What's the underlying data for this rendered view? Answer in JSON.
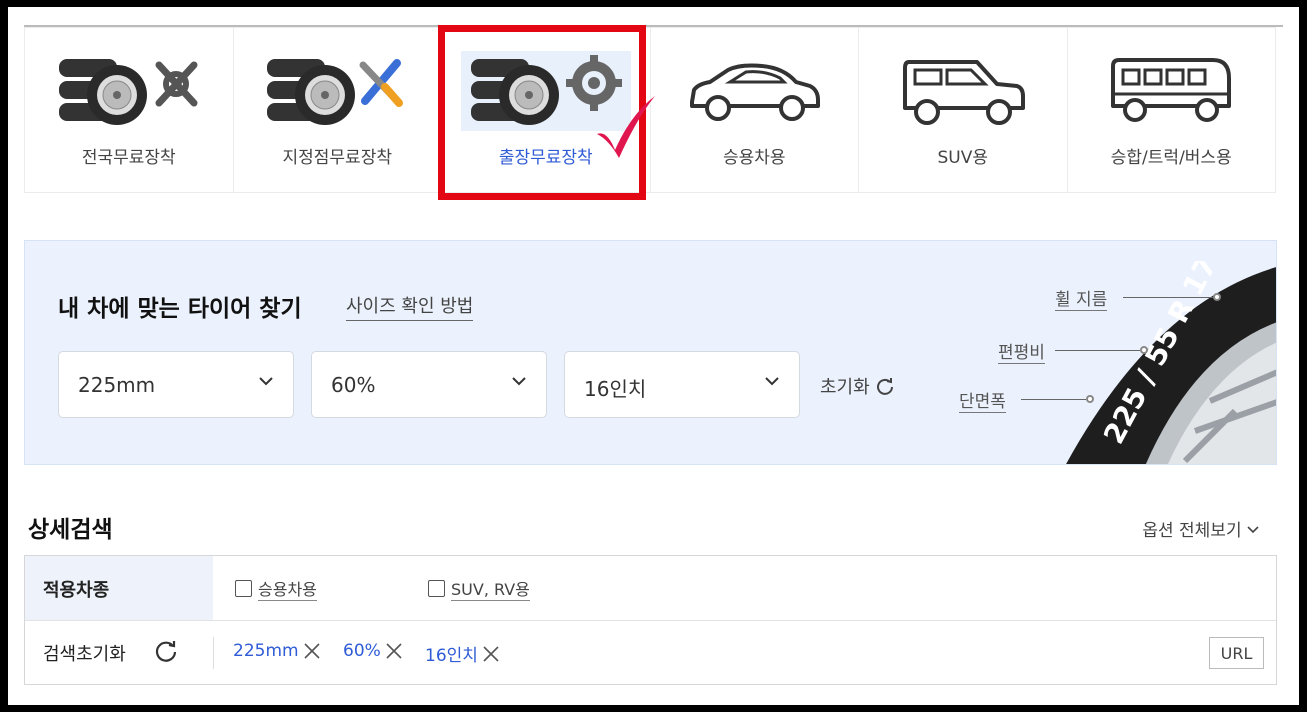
{
  "categories": [
    {
      "label": "전국무료장착",
      "icon": "tires-wrench-icon",
      "active": false
    },
    {
      "label": "지정점무료장착",
      "icon": "tires-tools-icon",
      "active": false
    },
    {
      "label": "출장무료장착",
      "icon": "tires-gear-icon",
      "active": true
    },
    {
      "label": "승용차용",
      "icon": "sedan-car-icon",
      "active": false
    },
    {
      "label": "SUV용",
      "icon": "suv-car-icon",
      "active": false
    },
    {
      "label": "승합/트럭/버스용",
      "icon": "bus-icon",
      "active": false
    }
  ],
  "finder": {
    "title": "내 차에 맞는 타이어 찾기",
    "howto_link": "사이즈 확인 방법",
    "width_value": "225mm",
    "ratio_value": "60%",
    "rim_value": "16인치",
    "reset_label": "초기화",
    "tire_labels": {
      "rim": "휠 지름",
      "flatness": "편평비",
      "section": "단면폭"
    },
    "tire_text": "225 / 55 R 17"
  },
  "detail": {
    "title": "상세검색",
    "view_all": "옵션 전체보기",
    "vehicle_type_label": "적용차종",
    "checkbox_passenger": "승용차용",
    "checkbox_suv": "SUV, RV용",
    "reset_label": "검색초기화",
    "chips": [
      "225mm",
      "60%",
      "16인치"
    ],
    "url_button": "URL"
  },
  "colors": {
    "accent": "#2f5bd6",
    "highlight": "#e30613",
    "finder_bg": "#ebf2fd"
  }
}
